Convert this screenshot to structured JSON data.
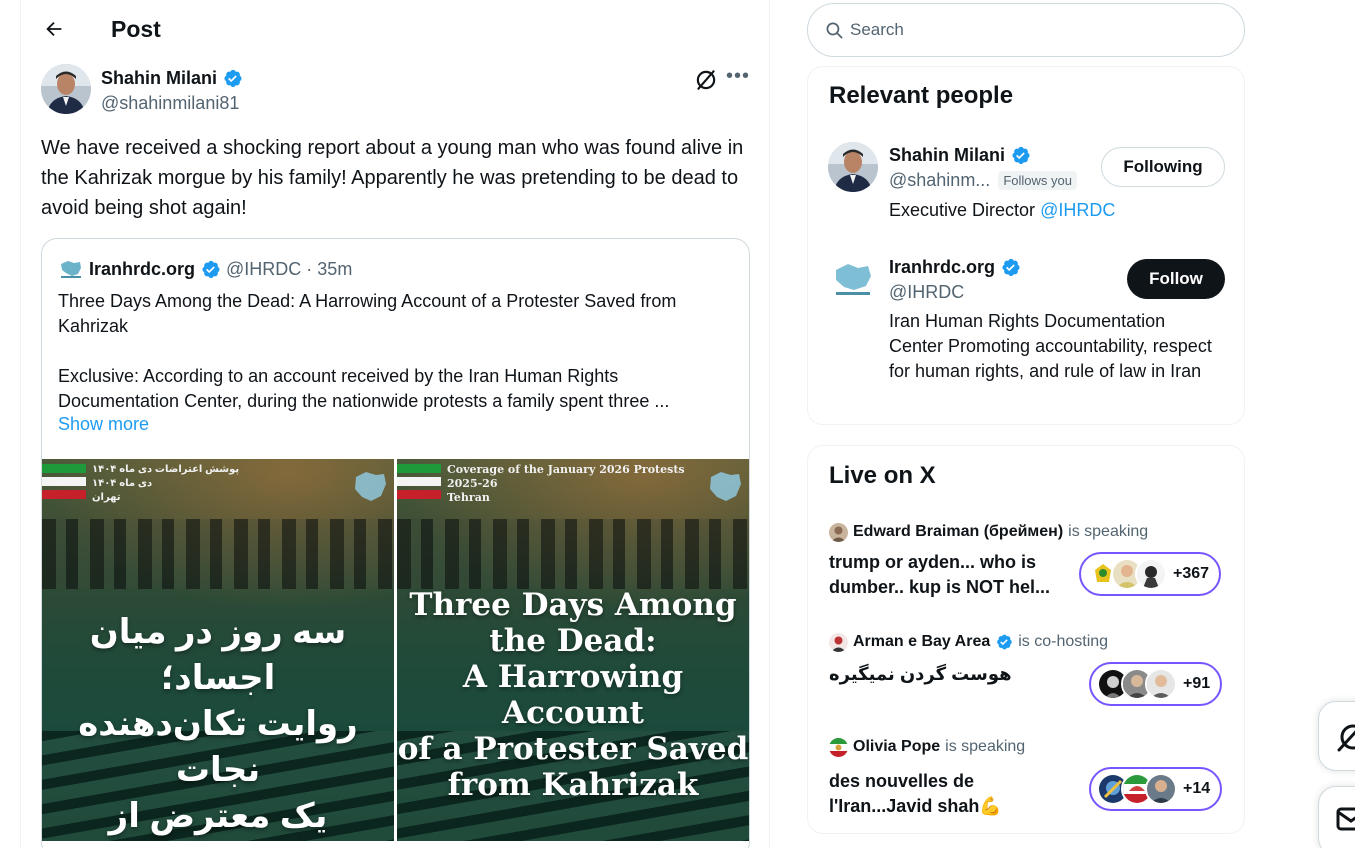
{
  "header": {
    "title": "Post"
  },
  "post": {
    "author_name": "Shahin Milani",
    "author_handle": "@shahinmilani81",
    "text": "We have received a shocking report about a young man who was found alive in the Kahrizak morgue by his family! Apparently he was pretending to be dead to avoid being shot again!",
    "icons": [
      "back-arrow-icon",
      "grok-icon",
      "more-icon",
      "verified-icon"
    ]
  },
  "quote": {
    "name": "Iranhrdc.org",
    "handle": "@IHRDC",
    "dot": "·",
    "time": "35m",
    "title": "Three Days Among the Dead: A Harrowing Account of a Protester Saved from Kahrizak",
    "body": "Exclusive: According to an account received by the Iran Human Rights Documentation Center, during the nationwide protests a family spent three ...",
    "show_more": "Show more",
    "image1": {
      "caption_lines": [
        "پوشش اعتراضات دی ماه ۱۴۰۴",
        "دی ماه ۱۴۰۴",
        "تهران"
      ],
      "headline_lines": [
        "سه روز در میان اجساد؛",
        "روایت تکان‌دهنده نجات",
        "یک معترض از کهریزک"
      ]
    },
    "image2": {
      "caption_lines": [
        "Coverage of  the January 2026 Protests",
        "2025-26",
        "Tehran"
      ],
      "headline_lines": [
        "Three Days Among",
        "the Dead:",
        "A Harrowing Account",
        "of a Protester Saved",
        "from Kahrizak"
      ]
    }
  },
  "search": {
    "placeholder": "Search"
  },
  "relevant_people": {
    "title": "Relevant people",
    "people": [
      {
        "name": "Shahin Milani",
        "handle": "@shahinm...",
        "badge": "Follows you",
        "bio_text": "Executive Director ",
        "bio_mention": "@IHRDC",
        "button": "Following"
      },
      {
        "name": "Iranhrdc.org",
        "handle": "@IHRDC",
        "bio_text": "Iran Human Rights Documentation Center Promoting accountability, respect for human rights, and rule of law in Iran",
        "button": "Follow"
      }
    ]
  },
  "live": {
    "title": "Live on X",
    "spaces": [
      {
        "host": "Edward Braiman (брeймен)",
        "status": "is speaking",
        "title": "trump or ayden... who is dumber.. kup is NOT hel...",
        "count": "+367"
      },
      {
        "host": "Arman e Bay Area",
        "status": "is co-hosting",
        "title": "هوست گردن نمیگیره",
        "count": "+91"
      },
      {
        "host": "Olivia Pope",
        "status": "is speaking",
        "title": "des nouvelles de l'Iran...Javid shah💪",
        "count": "+14"
      }
    ]
  },
  "colors": {
    "accent": "#1d9bf0",
    "spaces": "#7856ff",
    "text": "#0f1419",
    "muted": "#536471"
  }
}
